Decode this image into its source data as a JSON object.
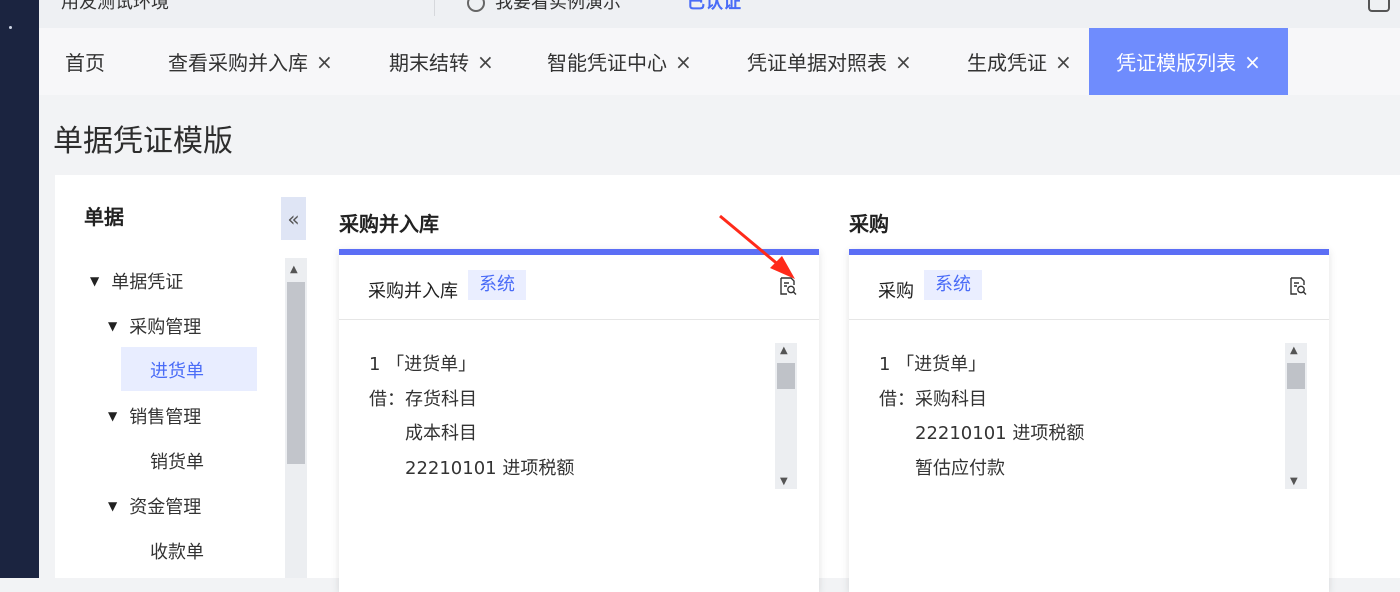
{
  "topbar": {
    "environment": "用友测试环境",
    "demo_link": "我要看实例演示",
    "auth_status": "已认证"
  },
  "tabs": [
    {
      "label": "首页",
      "closable": false
    },
    {
      "label": "查看采购并入库",
      "closable": true
    },
    {
      "label": "期末结转",
      "closable": true
    },
    {
      "label": "智能凭证中心",
      "closable": true
    },
    {
      "label": "凭证单据对照表",
      "closable": true
    },
    {
      "label": "生成凭证",
      "closable": true
    },
    {
      "label": "凭证模版列表",
      "closable": true,
      "active": true
    }
  ],
  "tab_close_glyph": "×",
  "page_title": "单据凭证模版",
  "tree": {
    "header": "单据",
    "collapse_glyph": "«",
    "nodes": {
      "root": "单据凭证",
      "purchase": "采购管理",
      "purchase_receipt": "进货单",
      "sales": "销售管理",
      "sales_delivery": "销货单",
      "funds": "资金管理",
      "funds_receipt": "收款单"
    }
  },
  "groups": [
    {
      "title": "采购并入库",
      "card": {
        "name": "采购并入库",
        "badge": "系统",
        "lines": [
          "1 「进货单」",
          "借：存货科目",
          "成本科目",
          "22210101 进项税额"
        ]
      }
    },
    {
      "title": "采购",
      "card": {
        "name": "采购",
        "badge": "系统",
        "lines": [
          "1 「进货单」",
          "借：采购科目",
          "22210101 进项税额",
          "暂估应付款"
        ]
      }
    }
  ],
  "colors": {
    "accent": "#5b6ef5",
    "active_tab": "#6f8cfd",
    "annotation_arrow": "#ff2a1a"
  }
}
